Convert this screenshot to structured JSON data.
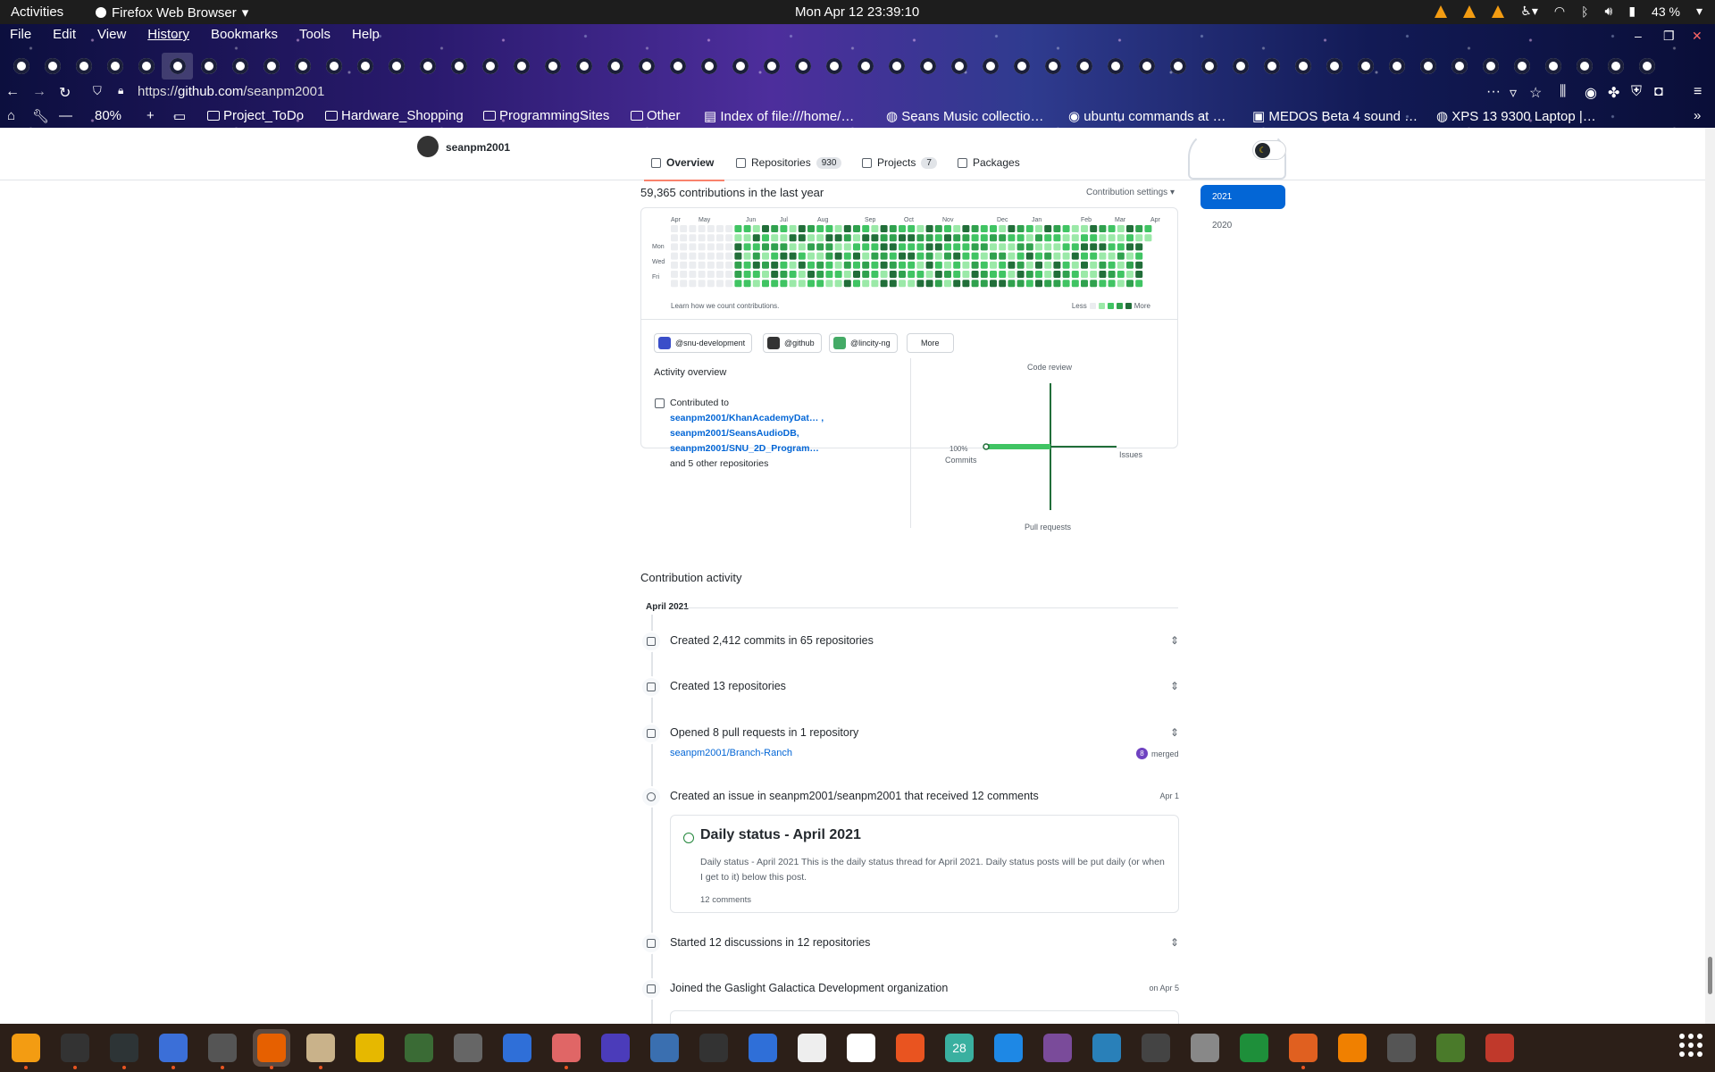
{
  "topbar": {
    "activities": "Activities",
    "app_name": "Firefox Web Browser",
    "clock": "Mon Apr 12  23:39:10",
    "battery": "43 %"
  },
  "menu": [
    "File",
    "Edit",
    "View",
    "History",
    "Bookmarks",
    "Tools",
    "Help"
  ],
  "address": {
    "url_prefix": "https://",
    "url_domain": "github.com",
    "url_path": "/seanpm2001"
  },
  "toolbar": {
    "zoom": "80%"
  },
  "bookmarks": [
    {
      "label": "Project_ToDo",
      "icon": "folder-icon"
    },
    {
      "label": "Hardware_Shopping",
      "icon": "folder-icon"
    },
    {
      "label": "ProgrammingSites",
      "icon": "folder-icon"
    },
    {
      "label": "Other",
      "icon": "folder-icon"
    },
    {
      "label": "Index of file:///home/…",
      "icon": "file-icon"
    },
    {
      "label": "Seans Music collectio…",
      "icon": "globe-icon"
    },
    {
      "label": "ubuntu commands at …",
      "icon": "bookmark-icon"
    },
    {
      "label": "MEDOS Beta 4 sound …",
      "icon": "bookmark-icon"
    },
    {
      "label": "XPS 13 9300 Laptop |…",
      "icon": "globe-icon"
    }
  ],
  "profile": {
    "username": "seanpm2001",
    "tabs": [
      {
        "label": "Overview"
      },
      {
        "label": "Repositories",
        "count": "930"
      },
      {
        "label": "Projects",
        "count": "7"
      },
      {
        "label": "Packages"
      }
    ]
  },
  "contributions": {
    "title": "59,365 contributions in the last year",
    "settings": "Contribution settings ▾",
    "months": [
      "Apr",
      "May",
      "Jun",
      "Jul",
      "Aug",
      "Sep",
      "Oct",
      "Nov",
      "Dec",
      "Jan",
      "Feb",
      "Mar",
      "Apr"
    ],
    "days": [
      "Mon",
      "Wed",
      "Fri"
    ],
    "learn": "Learn how we count contributions.",
    "less": "Less",
    "more": "More",
    "orgs": [
      "@snu-development",
      "@github",
      "@lincity-ng"
    ],
    "orgs_more": "More"
  },
  "years": [
    "2021",
    "2020"
  ],
  "activity_overview": {
    "title": "Activity overview",
    "contributed_to": "Contributed to",
    "repos": [
      "seanpm2001/KhanAcademyDat… ,",
      "seanpm2001/SeansAudioDB,",
      "seanpm2001/SNU_2D_Program…"
    ],
    "others": "and 5 other repositories",
    "axis": {
      "top": "Code review",
      "left_pct": "100%",
      "left": "Commits",
      "right": "Issues",
      "bottom": "Pull requests"
    }
  },
  "activity": {
    "title": "Contribution activity",
    "month": "April 2021",
    "events": [
      {
        "text": "Created 2,412 commits in 65 repositories"
      },
      {
        "text": "Created 13 repositories"
      },
      {
        "text": "Opened 8 pull requests in 1 repository",
        "repo": "seanpm2001/Branch-Ranch",
        "merged_count": "8",
        "merged": "merged"
      },
      {
        "text": "Created an issue in seanpm2001/seanpm2001 that received 12 comments",
        "date": "Apr 1"
      },
      {
        "text": "Started 12 discussions in 12 repositories"
      },
      {
        "text": "Joined the Gaslight Galactica Development organization",
        "date": "on Apr 5"
      }
    ],
    "issue": {
      "title": "Daily status - April 2021",
      "body": "Daily status - April 2021 This is the daily status thread for April 2021. Daily status posts will be put daily (or when I get to it) below this post.",
      "comments": "12 comments"
    }
  },
  "dock": [
    "vlc-icon",
    "terminal-icon",
    "system-monitor-icon",
    "text-editor-icon",
    "clock-icon",
    "firefox-icon",
    "files-icon",
    "calculator-icon",
    "gnome-games-icon",
    "settings-icon",
    "document-viewer-icon",
    "audio-editor-icon",
    "audio-icon",
    "virtualbox-icon",
    "inkscape-icon",
    "screenshot-icon",
    "typora-icon",
    "character-map-icon",
    "software-center-icon",
    "calendar-icon",
    "help-icon",
    "tweaks-icon",
    "remmina-icon",
    "app-store-icon",
    "image-viewer-icon",
    "spreadsheet-icon",
    "presentation-icon",
    "blender-icon",
    "gimp-icon",
    "minecraft-icon",
    "mario-icon"
  ],
  "calendar_label": "28"
}
